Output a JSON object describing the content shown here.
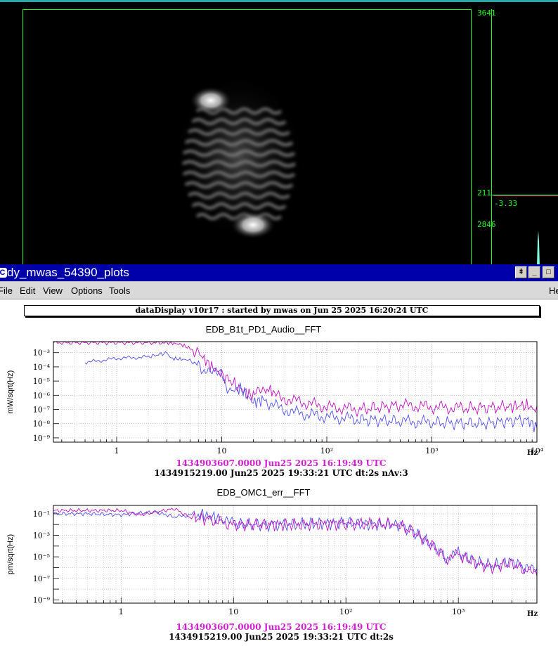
{
  "camera": {
    "labels": {
      "top": "3641",
      "mid": "211",
      "mid_value": "-3.33",
      "bottom": "2846"
    },
    "colors": {
      "frame": "#1aff1a",
      "profile": "#00ff88",
      "histogram": "#80ffe0"
    }
  },
  "window": {
    "title": "dy_mwas_54390_plots",
    "buttons": {
      "pin": "⯒",
      "minimize": "_",
      "maximize": "□"
    },
    "menu": {
      "file": "File",
      "edit": "Edit",
      "view": "View",
      "options": "Options",
      "tools": "Tools",
      "help": "He"
    }
  },
  "banner": "dataDisplay v10r17 : started by mwas on Jun 25 2025 16:20:24 UTC",
  "chart_data": [
    {
      "type": "line",
      "title": "EDB_B1t_PD1_Audio__FFT",
      "ylabel": "mW/sqrt(Hz)",
      "xlabel": "Hz",
      "x_scale": "log",
      "y_scale": "log",
      "xlim": [
        0.25,
        10000
      ],
      "ylim": [
        5e-10,
        0.006
      ],
      "x_ticks": [
        "1",
        "10",
        "10²",
        "10³",
        "10⁴"
      ],
      "y_ticks": [
        "10⁻³",
        "10⁻⁴",
        "10⁻⁵",
        "10⁻⁶",
        "10⁻⁷",
        "10⁻⁸",
        "10⁻⁹"
      ],
      "grid": true,
      "stamps": [
        "1434903607.0000 Jun25 2025 16:19:49 UTC",
        "1434915219.00 Jun25 2025 19:33:21 UTC dt:2s nAv:3"
      ],
      "series": [
        {
          "color": "#c010c0",
          "points": [
            [
              0.25,
              0.005
            ],
            [
              3,
              0.005
            ],
            [
              4,
              0.004
            ],
            [
              5,
              0.002
            ],
            [
              6,
              0.001
            ],
            [
              8,
              0.0001
            ],
            [
              10,
              3e-05
            ],
            [
              15,
              3e-06
            ],
            [
              20,
              8e-07
            ],
            [
              27,
              5e-06
            ],
            [
              30,
              1e-06
            ],
            [
              50,
              4e-07
            ],
            [
              100,
              1.5e-07
            ],
            [
              200,
              1e-07
            ],
            [
              500,
              2e-07
            ],
            [
              1000,
              1.5e-07
            ],
            [
              2000,
              1.2e-07
            ],
            [
              5000,
              1.5e-07
            ],
            [
              8000,
              2e-07
            ],
            [
              10000,
              8e-08
            ]
          ]
        },
        {
          "color": "#5050f0",
          "points": [
            [
              0.5,
              0.0002
            ],
            [
              1,
              0.0004
            ],
            [
              2,
              0.0005
            ],
            [
              3,
              0.001
            ],
            [
              3.3,
              0.0004
            ],
            [
              5,
              0.0003
            ],
            [
              7,
              5e-05
            ],
            [
              10,
              2e-05
            ],
            [
              12,
              2e-06
            ],
            [
              15,
              3e-06
            ],
            [
              20,
              3e-07
            ],
            [
              25,
              5e-07
            ],
            [
              30,
              2e-07
            ],
            [
              50,
              6e-08
            ],
            [
              100,
              3e-08
            ],
            [
              200,
              2e-08
            ],
            [
              500,
              1.5e-08
            ],
            [
              1000,
              1.2e-08
            ],
            [
              3000,
              1e-08
            ],
            [
              8000,
              2e-08
            ],
            [
              10000,
              5e-09
            ]
          ]
        }
      ]
    },
    {
      "type": "line",
      "title": "EDB_OMC1_err__FFT",
      "ylabel": "pm/sqrt(Hz)",
      "xlabel": "Hz",
      "x_scale": "log",
      "y_scale": "log",
      "xlim": [
        0.25,
        5000
      ],
      "ylim": [
        5e-10,
        0.6
      ],
      "x_ticks": [
        "1",
        "10",
        "10²",
        "10³"
      ],
      "y_ticks": [
        "10⁻¹",
        "10⁻³",
        "10⁻⁵",
        "10⁻⁷",
        "10⁻⁹"
      ],
      "grid": true,
      "stamps": [
        "1434903607.0000 Jun25 2025 16:19:49 UTC",
        "1434915219.00 Jun25 2025 19:33:21 UTC dt:2s"
      ],
      "series": [
        {
          "color": "#5050f0",
          "points": [
            [
              0.25,
              0.1
            ],
            [
              0.5,
              0.1
            ],
            [
              1,
              0.08
            ],
            [
              2,
              0.15
            ],
            [
              3,
              0.05
            ],
            [
              5,
              0.1
            ],
            [
              8,
              0.03
            ],
            [
              10,
              0.01
            ],
            [
              20,
              0.01
            ],
            [
              50,
              0.012
            ],
            [
              100,
              0.015
            ],
            [
              200,
              0.01
            ],
            [
              300,
              0.01
            ],
            [
              400,
              0.002
            ],
            [
              600,
              0.0001
            ],
            [
              800,
              6e-06
            ],
            [
              1000,
              2e-05
            ],
            [
              1500,
              3e-06
            ],
            [
              2000,
              1.5e-06
            ],
            [
              3000,
              4e-06
            ],
            [
              4000,
              8e-07
            ],
            [
              5000,
              3e-07
            ]
          ]
        },
        {
          "color": "#c010c0",
          "points": [
            [
              0.25,
              0.2
            ],
            [
              1,
              0.2
            ],
            [
              1.5,
              0.08
            ],
            [
              3,
              0.3
            ],
            [
              4,
              0.05
            ],
            [
              6,
              0.03
            ],
            [
              10,
              0.01
            ],
            [
              30,
              0.01
            ],
            [
              100,
              0.012
            ],
            [
              250,
              0.01
            ],
            [
              300,
              0.008
            ],
            [
              400,
              0.002
            ],
            [
              600,
              0.0001
            ],
            [
              800,
              5e-06
            ],
            [
              1000,
              1.5e-05
            ],
            [
              1500,
              2e-06
            ],
            [
              2000,
              1e-06
            ],
            [
              3000,
              2.5e-06
            ],
            [
              4000,
              5e-07
            ],
            [
              5000,
              1.5e-07
            ]
          ]
        }
      ]
    }
  ]
}
